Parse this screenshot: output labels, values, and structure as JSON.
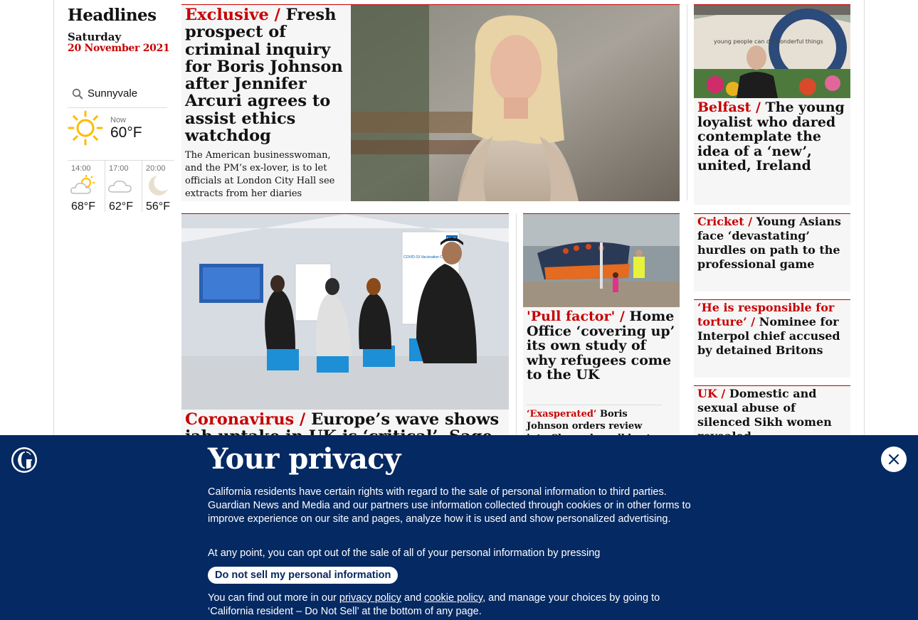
{
  "sidebar": {
    "title": "Headlines",
    "date_day": "Saturday",
    "date_full": "20 November 2021"
  },
  "weather": {
    "location": "Sunnyvale",
    "now_label": "Now",
    "now_temp": "60°F",
    "now_icon": "sun-icon",
    "forecast": [
      {
        "time": "14:00",
        "temp": "68°F",
        "icon": "partly-cloudy-icon"
      },
      {
        "time": "17:00",
        "temp": "62°F",
        "icon": "cloud-icon"
      },
      {
        "time": "20:00",
        "temp": "56°F",
        "icon": "moon-icon"
      }
    ]
  },
  "stories": {
    "main": {
      "kicker": "Exclusive /",
      "headline": "Fresh prospect of criminal inquiry for Boris Johnson after Jennifer Arcuri agrees to assist ethics watchdog",
      "standfirst": "The American businesswoman, and the PM’s ex-lover, is to let officials at London City Hall see extracts from her diaries"
    },
    "belfast": {
      "kicker": "Belfast /",
      "headline": "The young loyalist who dared contemplate the idea of a ‘new’, united, Ireland",
      "mural_text": "young people can do wonderful things"
    },
    "cricket": {
      "kicker": "Cricket /",
      "headline": "Young Asians face ‘devastating’ hurdles on path to the professional game"
    },
    "interpol": {
      "kicker": "‘He is responsible for torture’ /",
      "headline": "Nominee for Interpol chief accused by detained Britons"
    },
    "uk": {
      "kicker": "UK /",
      "headline": "Domestic and sexual abuse of silenced Sikh women revealed"
    },
    "coronavirus": {
      "kicker": "Coronavirus /",
      "headline": "Europe’s wave shows jab uptake in UK is ‘critical’, Sage member",
      "sign_nhs": "NHS",
      "sign_text": "COVID-19 Vaccination Centre"
    },
    "pull_factor": {
      "kicker": "'Pull factor' /",
      "headline": "Home Office ‘covering up’ its own study of why refugees come to the UK",
      "sub_kicker": "‘Exasperated’",
      "sub_text": "Boris Johnson orders review into Channel small boat crossings"
    }
  },
  "privacy": {
    "title": "Your privacy",
    "paragraph1": "California residents have certain rights with regard to the sale of personal information to third parties. Guardian News and Media and our partners use information collected through cookies or in other forms to improve experience on our site and pages, analyze how it is used and show personalized advertising.",
    "paragraph2": "At any point, you can opt out of the sale of all of your personal information by pressing",
    "button": "Do not sell my personal information",
    "p3_before": "You can find out more in our ",
    "privacy_link": "privacy policy",
    "p3_and": " and ",
    "cookie_link": "cookie policy",
    "p3_after": ", and manage your choices by going to ‘California resident – Do Not Sell’ at the bottom of any page.",
    "close_icon": "close-icon",
    "logo_icon": "guardian-logo-icon"
  },
  "colors": {
    "accent_red": "#c70000",
    "banner_blue": "#052962",
    "card_bg": "#f6f6f6"
  }
}
